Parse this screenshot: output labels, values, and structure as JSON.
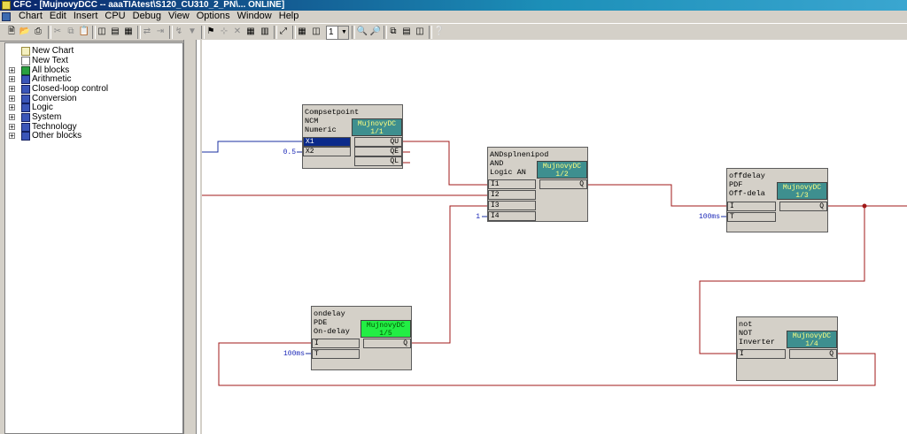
{
  "window": {
    "title": "CFC - [MujnovyDCC -- aaaTIAtest\\S120_CU310_2_PN\\... ONLINE]"
  },
  "menu": {
    "items": [
      "Chart",
      "Edit",
      "Insert",
      "CPU",
      "Debug",
      "View",
      "Options",
      "Window",
      "Help"
    ]
  },
  "toolbar": {
    "zoom_value": "1"
  },
  "sidebar": {
    "items": [
      {
        "label": "New Chart",
        "icon": "new-chart-icon",
        "expand": false
      },
      {
        "label": "New Text",
        "icon": "new-text-icon",
        "expand": false
      },
      {
        "label": "All blocks",
        "icon": "all-blocks-icon",
        "expand": true
      },
      {
        "label": "Arithmetic",
        "icon": "library-icon",
        "expand": true
      },
      {
        "label": "Closed-loop control",
        "icon": "library-icon",
        "expand": true
      },
      {
        "label": "Conversion",
        "icon": "library-icon",
        "expand": true
      },
      {
        "label": "Logic",
        "icon": "library-icon",
        "expand": true
      },
      {
        "label": "System",
        "icon": "library-icon",
        "expand": true
      },
      {
        "label": "Technology",
        "icon": "library-icon",
        "expand": true
      },
      {
        "label": "Other blocks",
        "icon": "library-icon",
        "expand": true
      }
    ]
  },
  "blocks": {
    "compsetpoint": {
      "name": "Compsetpoint",
      "type": "NCM",
      "comment": "Numeric",
      "instance": "MujnovyDC 1/1",
      "inputs": [
        "X1",
        "X2"
      ],
      "outputs": [
        "QU",
        "QE",
        "QL"
      ]
    },
    "andsplnenipod": {
      "name": "ANDsplnenipod",
      "type": "AND",
      "comment": "Logic AN",
      "instance": "MujnovyDC 1/2",
      "inputs": [
        "I1",
        "I2",
        "I3",
        "I4"
      ],
      "outputs": [
        "Q"
      ]
    },
    "offdelay": {
      "name": "offdelay",
      "type": "PDF",
      "comment": "Off-dela",
      "instance": "MujnovyDC 1/3",
      "inputs": [
        "I",
        "T"
      ],
      "outputs": [
        "Q"
      ]
    },
    "ondelay": {
      "name": "ondelay",
      "type": "PDE",
      "comment": "On-delay",
      "instance": "MujnovyDC 1/5",
      "inputs": [
        "I",
        "T"
      ],
      "outputs": [
        "Q"
      ]
    },
    "not": {
      "name": "not",
      "type": "NOT",
      "comment": "Inverter",
      "instance": "MujnovyDC 1/4",
      "inputs": [
        "I"
      ],
      "outputs": [
        "Q"
      ]
    }
  },
  "values": {
    "compsetpoint_x2": "0.5",
    "and_i4": "1",
    "offdelay_t": "100ms",
    "ondelay_t": "100ms"
  },
  "colors": {
    "wire_red": "#a01818",
    "wire_blue": "#1a2fa0",
    "instance_teal": "#3e8f8f",
    "instance_green": "#22ee44",
    "value_blue": "#1a27b8"
  }
}
